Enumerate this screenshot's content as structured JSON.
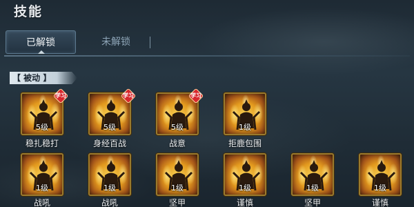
{
  "header": {
    "title": "技能"
  },
  "tabs": [
    {
      "label": "已解锁",
      "active": true
    },
    {
      "label": "未解锁",
      "active": false
    }
  ],
  "section": {
    "label": "【 被动 】"
  },
  "badge_text": "学习",
  "colors": {
    "accent_gold": "#9a7a2c",
    "badge_red": "#d8282e",
    "tab_active_border": "#5d7a90",
    "inactive_tab_text": "#8fa6b8"
  },
  "skills_row1": [
    {
      "name": "稳扎稳打",
      "level": "5级",
      "learnable": true
    },
    {
      "name": "身经百战",
      "level": "5级",
      "learnable": true
    },
    {
      "name": "战意",
      "level": "5级",
      "learnable": true
    },
    {
      "name": "拒鹿包围",
      "level": "1级",
      "learnable": false
    }
  ],
  "skills_row2": [
    {
      "name": "战吼",
      "level": "1级",
      "learnable": false
    },
    {
      "name": "战吼",
      "level": "1级",
      "learnable": false
    },
    {
      "name": "坚甲",
      "level": "1级",
      "learnable": false
    },
    {
      "name": "谨慎",
      "level": "1级",
      "learnable": false
    },
    {
      "name": "坚甲",
      "level": "1级",
      "learnable": false
    },
    {
      "name": "谨慎",
      "level": "1级",
      "learnable": false
    }
  ]
}
